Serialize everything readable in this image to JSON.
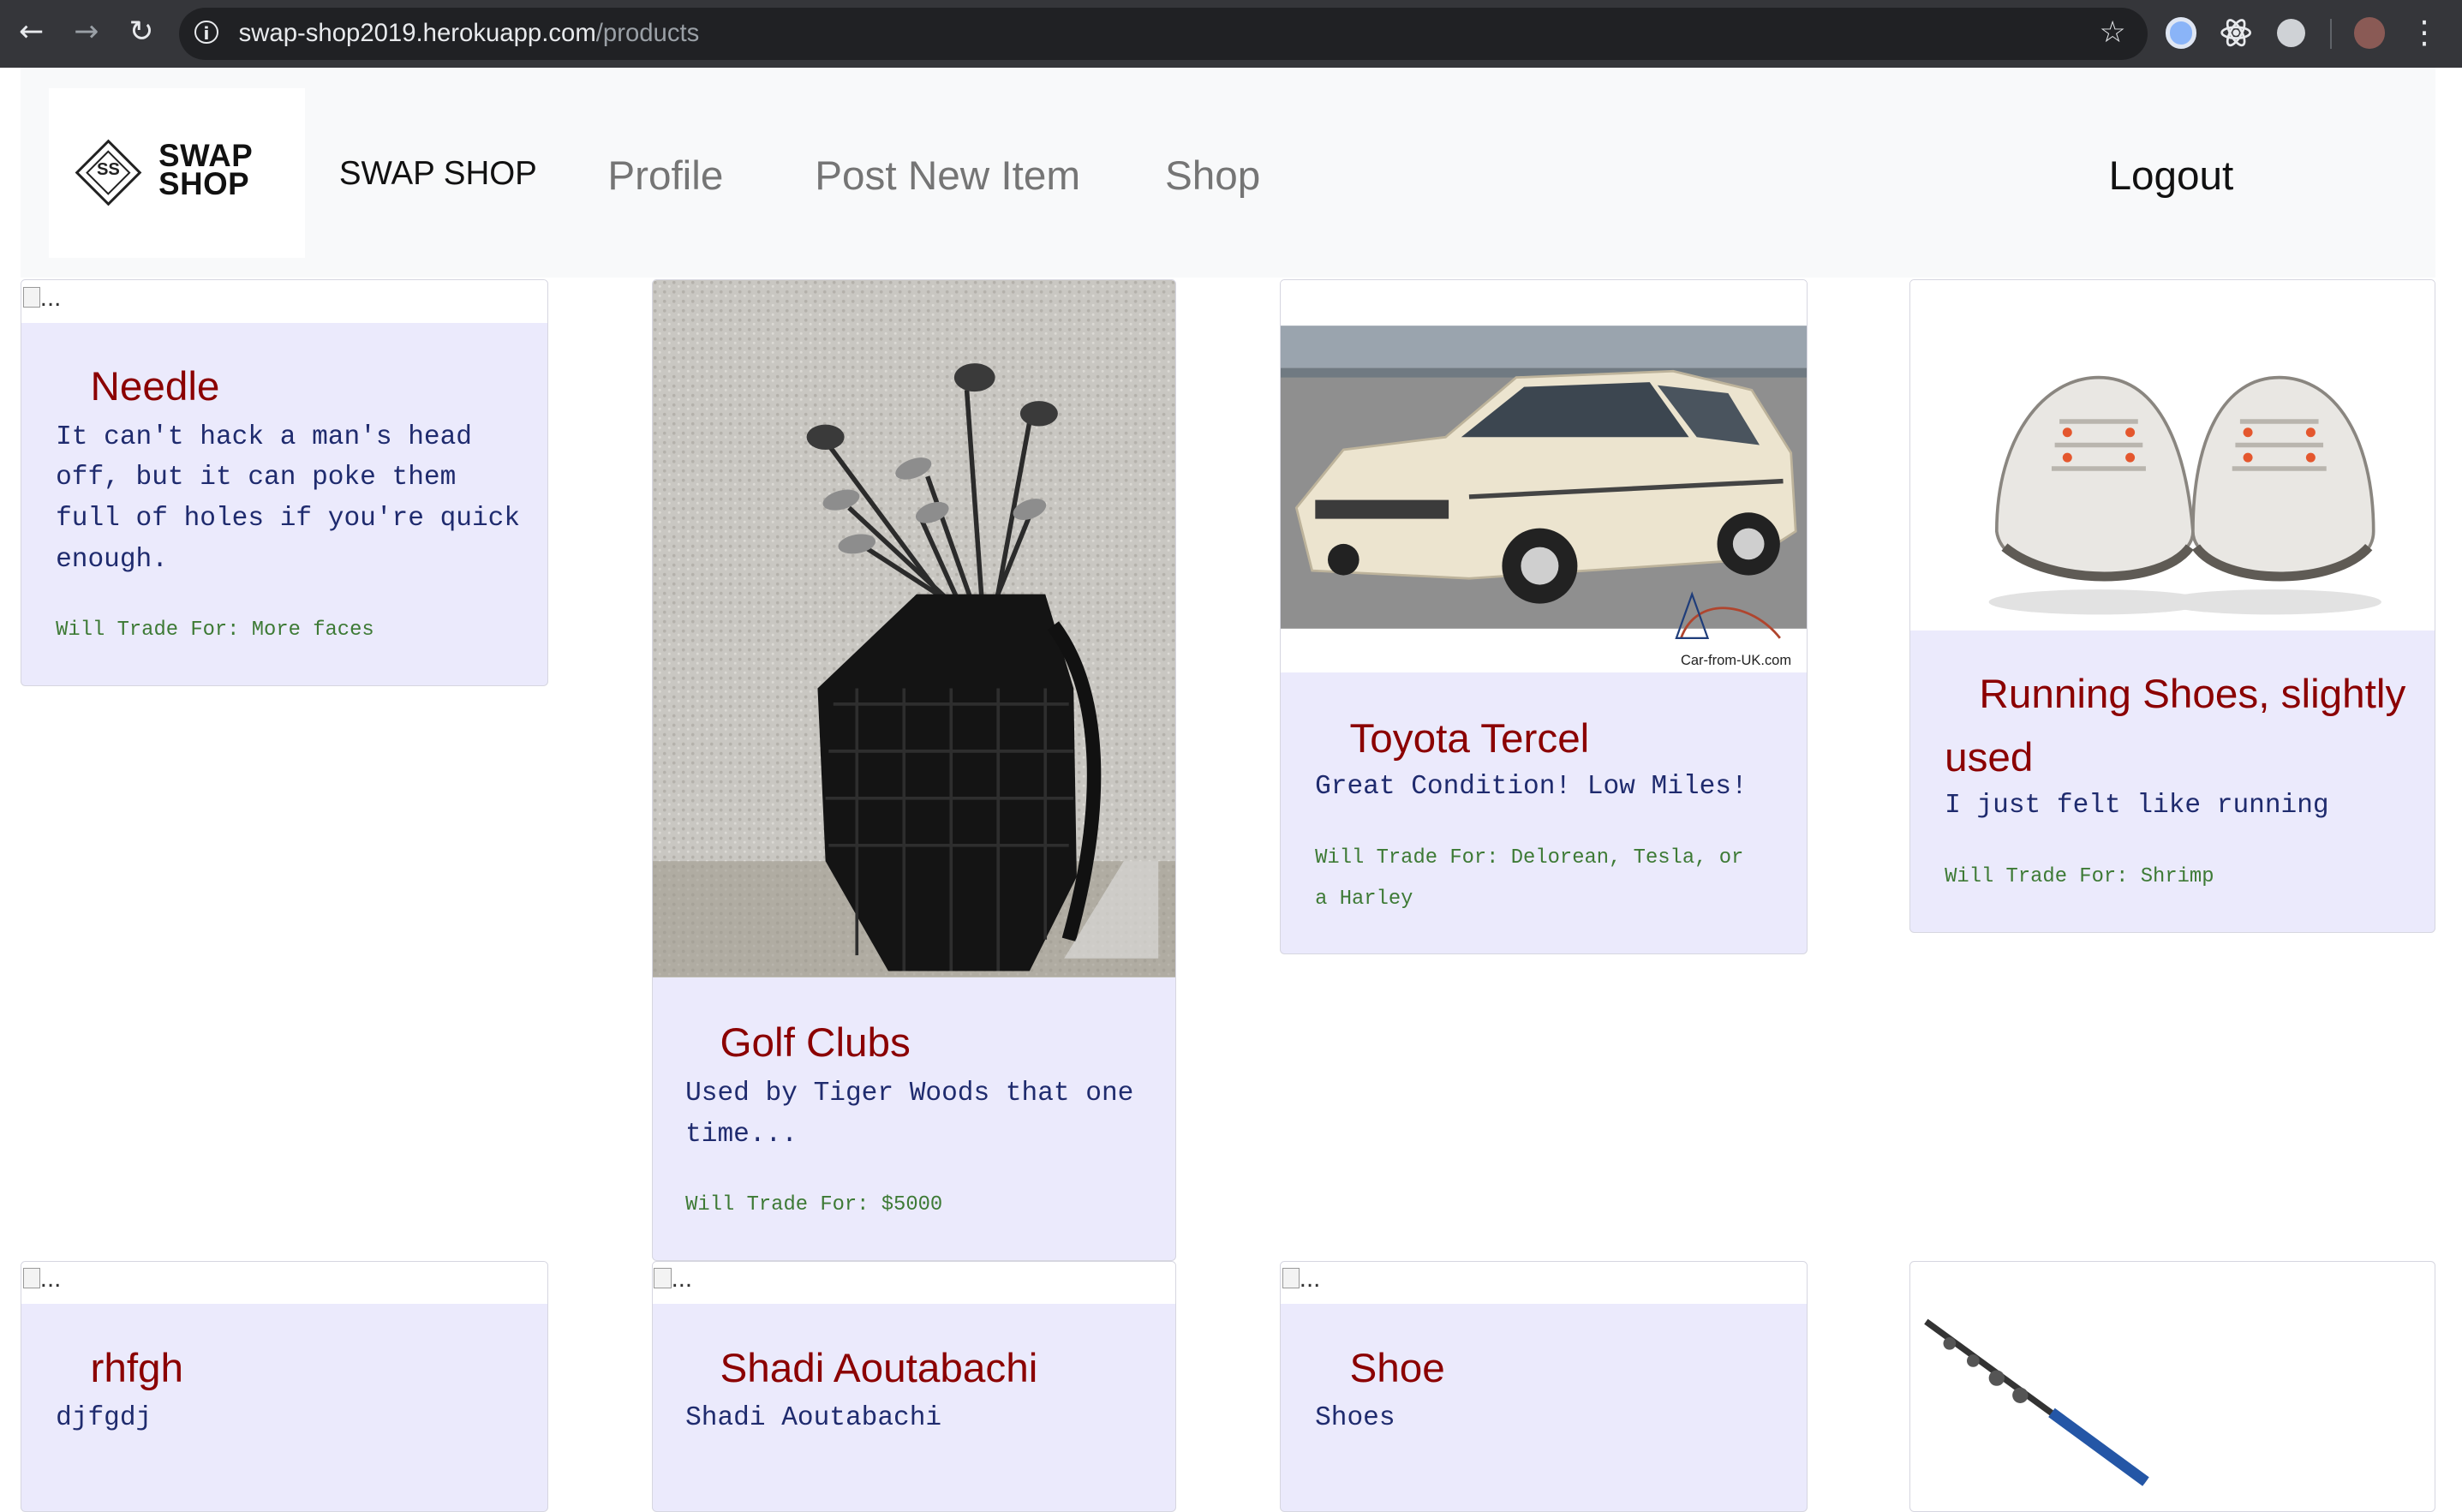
{
  "browser": {
    "url_host": "swap-shop2019.herokuapp.com",
    "url_path": "/products",
    "back_icon": "←",
    "forward_icon": "→",
    "reload_icon": "↻",
    "info_icon": "i",
    "star_icon": "☆",
    "menu_icon": "⋮"
  },
  "navbar": {
    "logo_initials": "SS",
    "logo_line1": "SWAP",
    "logo_line2": "SHOP",
    "brand": "SWAP SHOP",
    "links": [
      "Profile",
      "Post New Item",
      "Shop"
    ],
    "logout": "Logout"
  },
  "broken_alt": "...",
  "products": [
    {
      "title": "Needle",
      "description": "It can't hack a man's head off, but it can poke them full of holes if you're quick enough.",
      "trade": "Will Trade For: More faces",
      "image": "broken"
    },
    {
      "title": "Golf Clubs",
      "description": "Used by Tiger Woods that one time...",
      "trade": "Will Trade For: $5000",
      "image": "golf-bag"
    },
    {
      "title": "Toyota Tercel",
      "description": "Great Condition! Low Miles!",
      "trade": "Will Trade For: Delorean, Tesla, or a Harley",
      "image": "car",
      "image_watermark": "Car-from-UK.com"
    },
    {
      "title": "Running Shoes, slightly used",
      "description": "I just felt like running",
      "trade": "Will Trade For: Shrimp",
      "image": "shoes"
    },
    {
      "title": "rhfgh",
      "description": "djfgdj",
      "image": "broken"
    },
    {
      "title": "Shadi Aoutabachi",
      "description": "Shadi Aoutabachi",
      "image": "broken"
    },
    {
      "title": "Shoe",
      "description": "Shoes",
      "image": "broken"
    },
    {
      "image": "fishing-rod"
    }
  ],
  "colors": {
    "card_bg": "#ebeafc",
    "title": "#8b0000",
    "description": "#1f2b6e",
    "trade": "#3d7a35"
  }
}
